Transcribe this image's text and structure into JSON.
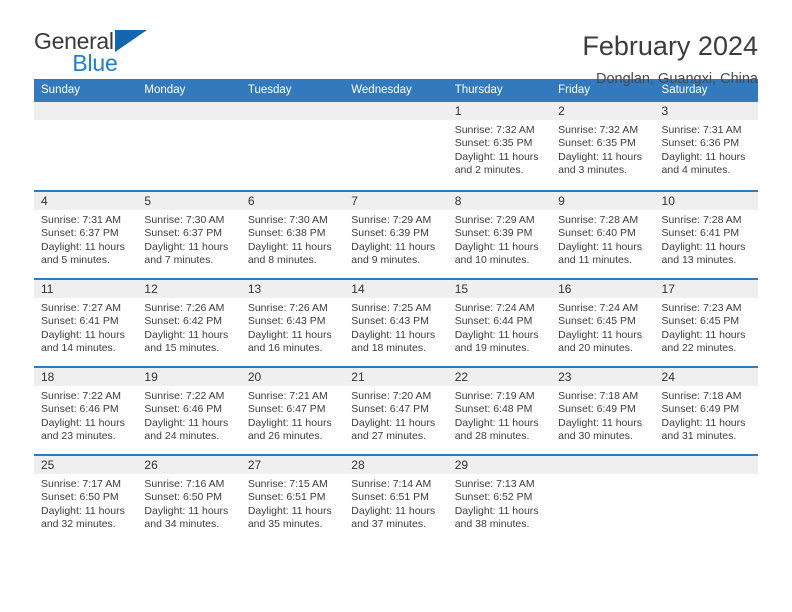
{
  "brand": {
    "name_part1": "General",
    "name_part2": "Blue",
    "mark_color": "#1466b0",
    "blue_color": "#1b7fd4"
  },
  "header": {
    "title": "February 2024",
    "subtitle": "Donglan, Guangxi, China"
  },
  "theme": {
    "header_blue": "#3279bd",
    "day_band_gray": "#efefef",
    "text_color": "#3c3c3c"
  },
  "weekdays": [
    "Sunday",
    "Monday",
    "Tuesday",
    "Wednesday",
    "Thursday",
    "Friday",
    "Saturday"
  ],
  "labels": {
    "sunrise_prefix": "Sunrise:",
    "sunset_prefix": "Sunset:",
    "daylight_prefix": "Daylight:"
  },
  "weeks": [
    [
      {
        "day": "",
        "line1": "",
        "line2": "",
        "line3": "",
        "line4": ""
      },
      {
        "day": "",
        "line1": "",
        "line2": "",
        "line3": "",
        "line4": ""
      },
      {
        "day": "",
        "line1": "",
        "line2": "",
        "line3": "",
        "line4": ""
      },
      {
        "day": "",
        "line1": "",
        "line2": "",
        "line3": "",
        "line4": ""
      },
      {
        "day": "1",
        "line1": "Sunrise: 7:32 AM",
        "line2": "Sunset: 6:35 PM",
        "line3": "Daylight: 11 hours",
        "line4": "and 2 minutes."
      },
      {
        "day": "2",
        "line1": "Sunrise: 7:32 AM",
        "line2": "Sunset: 6:35 PM",
        "line3": "Daylight: 11 hours",
        "line4": "and 3 minutes."
      },
      {
        "day": "3",
        "line1": "Sunrise: 7:31 AM",
        "line2": "Sunset: 6:36 PM",
        "line3": "Daylight: 11 hours",
        "line4": "and 4 minutes."
      }
    ],
    [
      {
        "day": "4",
        "line1": "Sunrise: 7:31 AM",
        "line2": "Sunset: 6:37 PM",
        "line3": "Daylight: 11 hours",
        "line4": "and 5 minutes."
      },
      {
        "day": "5",
        "line1": "Sunrise: 7:30 AM",
        "line2": "Sunset: 6:37 PM",
        "line3": "Daylight: 11 hours",
        "line4": "and 7 minutes."
      },
      {
        "day": "6",
        "line1": "Sunrise: 7:30 AM",
        "line2": "Sunset: 6:38 PM",
        "line3": "Daylight: 11 hours",
        "line4": "and 8 minutes."
      },
      {
        "day": "7",
        "line1": "Sunrise: 7:29 AM",
        "line2": "Sunset: 6:39 PM",
        "line3": "Daylight: 11 hours",
        "line4": "and 9 minutes."
      },
      {
        "day": "8",
        "line1": "Sunrise: 7:29 AM",
        "line2": "Sunset: 6:39 PM",
        "line3": "Daylight: 11 hours",
        "line4": "and 10 minutes."
      },
      {
        "day": "9",
        "line1": "Sunrise: 7:28 AM",
        "line2": "Sunset: 6:40 PM",
        "line3": "Daylight: 11 hours",
        "line4": "and 11 minutes."
      },
      {
        "day": "10",
        "line1": "Sunrise: 7:28 AM",
        "line2": "Sunset: 6:41 PM",
        "line3": "Daylight: 11 hours",
        "line4": "and 13 minutes."
      }
    ],
    [
      {
        "day": "11",
        "line1": "Sunrise: 7:27 AM",
        "line2": "Sunset: 6:41 PM",
        "line3": "Daylight: 11 hours",
        "line4": "and 14 minutes."
      },
      {
        "day": "12",
        "line1": "Sunrise: 7:26 AM",
        "line2": "Sunset: 6:42 PM",
        "line3": "Daylight: 11 hours",
        "line4": "and 15 minutes."
      },
      {
        "day": "13",
        "line1": "Sunrise: 7:26 AM",
        "line2": "Sunset: 6:43 PM",
        "line3": "Daylight: 11 hours",
        "line4": "and 16 minutes."
      },
      {
        "day": "14",
        "line1": "Sunrise: 7:25 AM",
        "line2": "Sunset: 6:43 PM",
        "line3": "Daylight: 11 hours",
        "line4": "and 18 minutes."
      },
      {
        "day": "15",
        "line1": "Sunrise: 7:24 AM",
        "line2": "Sunset: 6:44 PM",
        "line3": "Daylight: 11 hours",
        "line4": "and 19 minutes."
      },
      {
        "day": "16",
        "line1": "Sunrise: 7:24 AM",
        "line2": "Sunset: 6:45 PM",
        "line3": "Daylight: 11 hours",
        "line4": "and 20 minutes."
      },
      {
        "day": "17",
        "line1": "Sunrise: 7:23 AM",
        "line2": "Sunset: 6:45 PM",
        "line3": "Daylight: 11 hours",
        "line4": "and 22 minutes."
      }
    ],
    [
      {
        "day": "18",
        "line1": "Sunrise: 7:22 AM",
        "line2": "Sunset: 6:46 PM",
        "line3": "Daylight: 11 hours",
        "line4": "and 23 minutes."
      },
      {
        "day": "19",
        "line1": "Sunrise: 7:22 AM",
        "line2": "Sunset: 6:46 PM",
        "line3": "Daylight: 11 hours",
        "line4": "and 24 minutes."
      },
      {
        "day": "20",
        "line1": "Sunrise: 7:21 AM",
        "line2": "Sunset: 6:47 PM",
        "line3": "Daylight: 11 hours",
        "line4": "and 26 minutes."
      },
      {
        "day": "21",
        "line1": "Sunrise: 7:20 AM",
        "line2": "Sunset: 6:47 PM",
        "line3": "Daylight: 11 hours",
        "line4": "and 27 minutes."
      },
      {
        "day": "22",
        "line1": "Sunrise: 7:19 AM",
        "line2": "Sunset: 6:48 PM",
        "line3": "Daylight: 11 hours",
        "line4": "and 28 minutes."
      },
      {
        "day": "23",
        "line1": "Sunrise: 7:18 AM",
        "line2": "Sunset: 6:49 PM",
        "line3": "Daylight: 11 hours",
        "line4": "and 30 minutes."
      },
      {
        "day": "24",
        "line1": "Sunrise: 7:18 AM",
        "line2": "Sunset: 6:49 PM",
        "line3": "Daylight: 11 hours",
        "line4": "and 31 minutes."
      }
    ],
    [
      {
        "day": "25",
        "line1": "Sunrise: 7:17 AM",
        "line2": "Sunset: 6:50 PM",
        "line3": "Daylight: 11 hours",
        "line4": "and 32 minutes."
      },
      {
        "day": "26",
        "line1": "Sunrise: 7:16 AM",
        "line2": "Sunset: 6:50 PM",
        "line3": "Daylight: 11 hours",
        "line4": "and 34 minutes."
      },
      {
        "day": "27",
        "line1": "Sunrise: 7:15 AM",
        "line2": "Sunset: 6:51 PM",
        "line3": "Daylight: 11 hours",
        "line4": "and 35 minutes."
      },
      {
        "day": "28",
        "line1": "Sunrise: 7:14 AM",
        "line2": "Sunset: 6:51 PM",
        "line3": "Daylight: 11 hours",
        "line4": "and 37 minutes."
      },
      {
        "day": "29",
        "line1": "Sunrise: 7:13 AM",
        "line2": "Sunset: 6:52 PM",
        "line3": "Daylight: 11 hours",
        "line4": "and 38 minutes."
      },
      {
        "day": "",
        "line1": "",
        "line2": "",
        "line3": "",
        "line4": ""
      },
      {
        "day": "",
        "line1": "",
        "line2": "",
        "line3": "",
        "line4": ""
      }
    ]
  ]
}
